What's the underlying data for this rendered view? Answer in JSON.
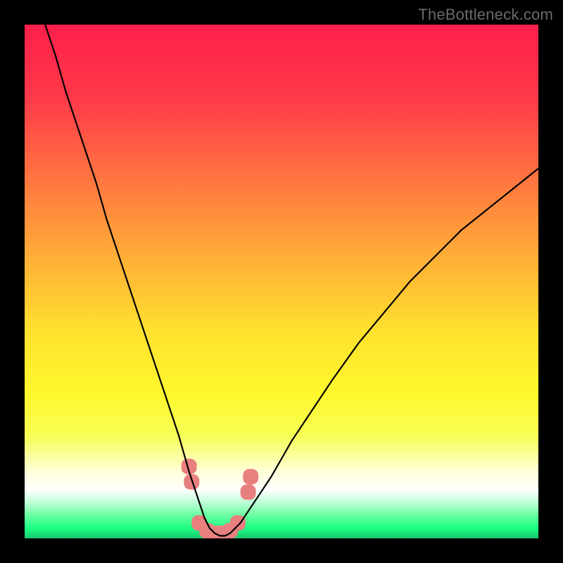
{
  "watermark": "TheBottleneck.com",
  "chart_data": {
    "type": "line",
    "title": "",
    "xlabel": "",
    "ylabel": "",
    "xlim": [
      0,
      100
    ],
    "ylim": [
      0,
      100
    ],
    "background_gradient": {
      "description": "vertical rainbow gradient representing bottleneck severity (red=high, green=low)",
      "stops": [
        {
          "pos": 0.0,
          "color": "#ff1f4b"
        },
        {
          "pos": 0.14,
          "color": "#ff394a"
        },
        {
          "pos": 0.3,
          "color": "#ff7540"
        },
        {
          "pos": 0.45,
          "color": "#ffad36"
        },
        {
          "pos": 0.6,
          "color": "#ffe22e"
        },
        {
          "pos": 0.72,
          "color": "#fff82d"
        },
        {
          "pos": 0.8,
          "color": "#f6ff55"
        },
        {
          "pos": 0.87,
          "color": "#ffffd8"
        },
        {
          "pos": 0.905,
          "color": "#ffffff"
        },
        {
          "pos": 0.93,
          "color": "#bfffd8"
        },
        {
          "pos": 0.955,
          "color": "#6affa0"
        },
        {
          "pos": 0.98,
          "color": "#1cff84"
        },
        {
          "pos": 1.0,
          "color": "#19c76c"
        }
      ]
    },
    "series": [
      {
        "name": "bottleneck-curve",
        "color": "#000000",
        "x": [
          4,
          6,
          8,
          10,
          12,
          14,
          16,
          18,
          20,
          22,
          24,
          26,
          28,
          30,
          32,
          33,
          34,
          35,
          36,
          37,
          38,
          39,
          40,
          42,
          44,
          48,
          52,
          56,
          60,
          65,
          70,
          75,
          80,
          85,
          90,
          95,
          100
        ],
        "y": [
          100,
          94,
          87,
          81,
          75,
          69,
          62,
          56,
          50,
          44,
          38,
          32,
          26,
          20,
          13,
          10,
          7,
          4,
          2,
          1,
          0.5,
          0.5,
          1,
          3,
          6,
          12,
          19,
          25,
          31,
          38,
          44,
          50,
          55,
          60,
          64,
          68,
          72
        ]
      }
    ],
    "markers": {
      "description": "salmon rounded markers near curve minimum",
      "color": "#e98080",
      "points": [
        {
          "x": 32.0,
          "y": 14
        },
        {
          "x": 32.5,
          "y": 11
        },
        {
          "x": 34.0,
          "y": 3
        },
        {
          "x": 35.5,
          "y": 1.5
        },
        {
          "x": 37.0,
          "y": 1
        },
        {
          "x": 38.5,
          "y": 1
        },
        {
          "x": 40.0,
          "y": 1.5
        },
        {
          "x": 41.5,
          "y": 3
        },
        {
          "x": 43.5,
          "y": 9
        },
        {
          "x": 44.0,
          "y": 12
        }
      ]
    }
  }
}
